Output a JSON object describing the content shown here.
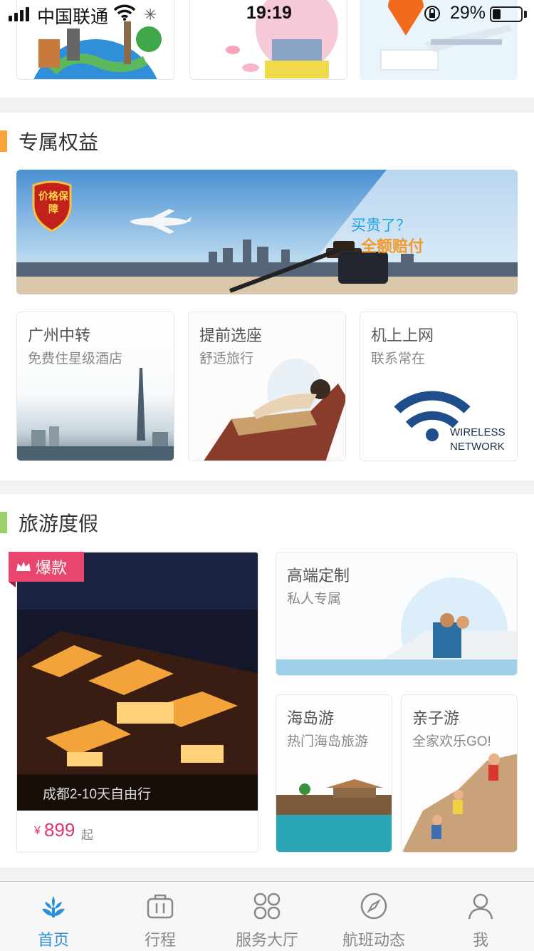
{
  "status_bar": {
    "carrier": "中国联通",
    "time": "19:19",
    "battery_percent": "29%",
    "battery_level": 0.29
  },
  "benefits": {
    "section_title": "专属权益",
    "accent_color": "#f9a43a",
    "banner": {
      "badge": "价格保障",
      "line1": "买贵了？",
      "line2": "全额赔付"
    },
    "cards": [
      {
        "title": "广州中转",
        "subtitle": "免费住星级酒店"
      },
      {
        "title": "提前选座",
        "subtitle": "舒适旅行"
      },
      {
        "title": "机上上网",
        "subtitle": "联系常在",
        "graphic_text_1": "WIRELESS",
        "graphic_text_2": "NETWORK"
      }
    ]
  },
  "travel": {
    "section_title": "旅游度假",
    "accent_color": "#9cd068",
    "hot": {
      "badge": "爆款",
      "caption": "成都2-10天自由行",
      "price_currency": "¥",
      "price": "899",
      "price_suffix": "起"
    },
    "cards": [
      {
        "title": "高端定制",
        "subtitle": "私人专属"
      },
      {
        "title": "海岛游",
        "subtitle": "热门海岛旅游"
      },
      {
        "title": "亲子游",
        "subtitle": "全家欢乐GO!"
      }
    ]
  },
  "tab_bar": {
    "active_color": "#2a8fd6",
    "items": [
      {
        "label": "首页",
        "icon": "home-logo-icon",
        "active": true
      },
      {
        "label": "行程",
        "icon": "luggage-icon",
        "active": false
      },
      {
        "label": "服务大厅",
        "icon": "service-grid-icon",
        "active": false
      },
      {
        "label": "航班动态",
        "icon": "compass-icon",
        "active": false
      },
      {
        "label": "我",
        "icon": "user-icon",
        "active": false
      }
    ]
  }
}
